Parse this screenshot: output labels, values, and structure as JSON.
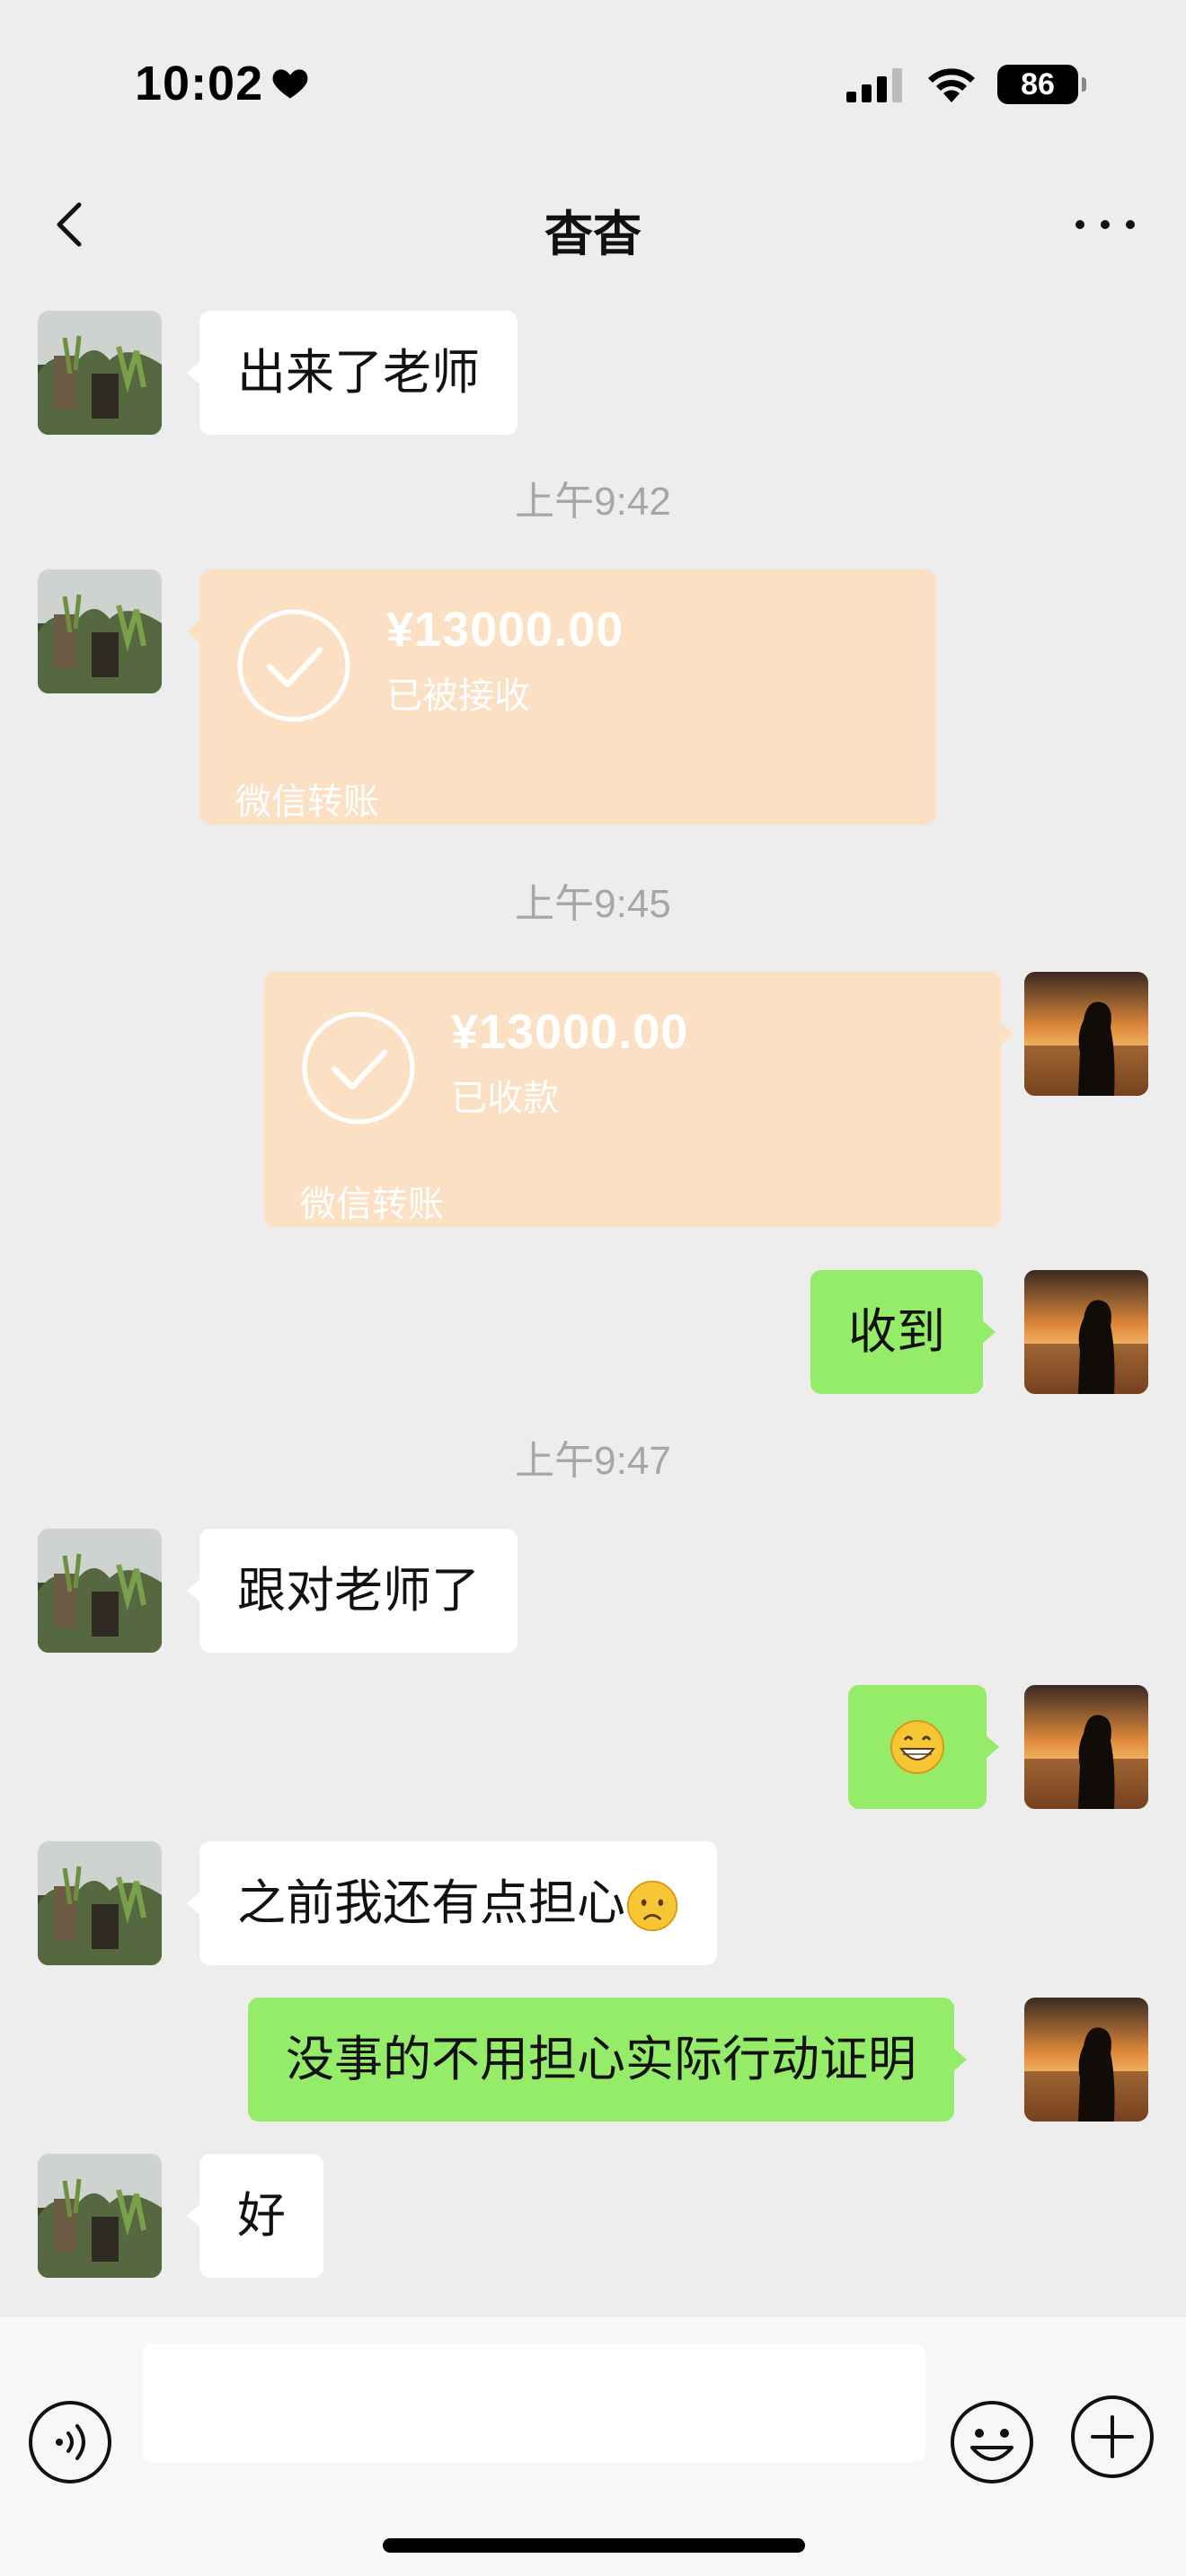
{
  "status_bar": {
    "time": "10:02",
    "battery": "86"
  },
  "nav": {
    "title": "杳杳"
  },
  "messages": {
    "m1": "出来了老师",
    "ts1": "上午9:42",
    "transfer1": {
      "amount": "¥13000.00",
      "status": "已被接收",
      "label": "微信转账"
    },
    "ts2": "上午9:45",
    "transfer2": {
      "amount": "¥13000.00",
      "status": "已收款",
      "label": "微信转账"
    },
    "m2": "收到",
    "ts3": "上午9:47",
    "m3": "跟对老师了",
    "m4_emoji": "grinning-face-emoji",
    "m5": "之前我还有点担心",
    "m5_emoji": "worried-face-emoji",
    "m6": "没事的不用担心实际行动证明",
    "m7": "好"
  },
  "input": {
    "placeholder": ""
  },
  "colors": {
    "background": "#ededed",
    "green_bubble": "#95ec69",
    "white_bubble": "#ffffff",
    "transfer_card": "#fbe0c3",
    "timestamp": "#a6a6a6"
  }
}
